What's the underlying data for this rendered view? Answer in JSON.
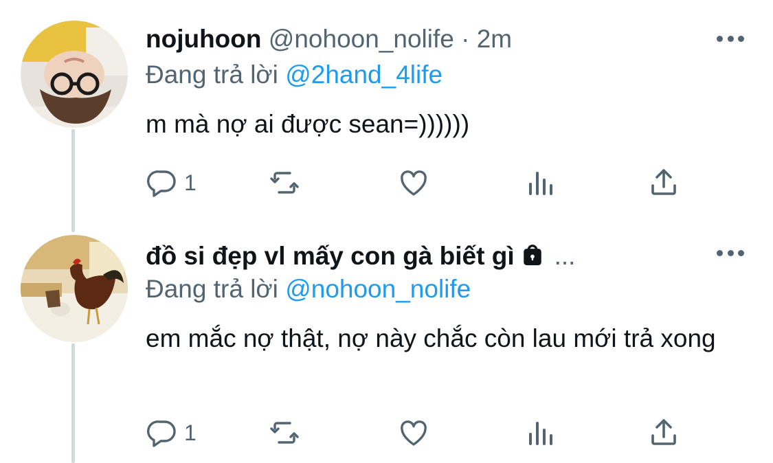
{
  "tweets": [
    {
      "display_name": "nojuhoon",
      "handle": "@nohoon_nolife",
      "separator": "·",
      "time": "2m",
      "replying_prefix": "Đang trả lời",
      "replying_to": "@2hand_4life",
      "text": "m mà nợ ai được sean=))))))",
      "reply_count": "1",
      "avatar_icon": "person-with-glasses-photo"
    },
    {
      "display_name": "đồ si đẹp vl mấy con gà biết gì",
      "name_ellipsis": "...",
      "lock_icon": "lock-icon",
      "replying_prefix": "Đang trả lời",
      "replying_to": "@nohoon_nolife",
      "text": "em mắc nợ thật, nợ này chắc còn lau mới trả xong",
      "reply_count": "1",
      "avatar_icon": "rooster-pouring-coffee-photo"
    }
  ],
  "colors": {
    "text": "#0f1419",
    "secondary": "#536471",
    "accent": "#1d9bf0",
    "thread_line": "#cfd9de"
  },
  "action_icons": [
    "reply-icon",
    "retweet-icon",
    "like-icon",
    "analytics-icon",
    "share-icon"
  ]
}
